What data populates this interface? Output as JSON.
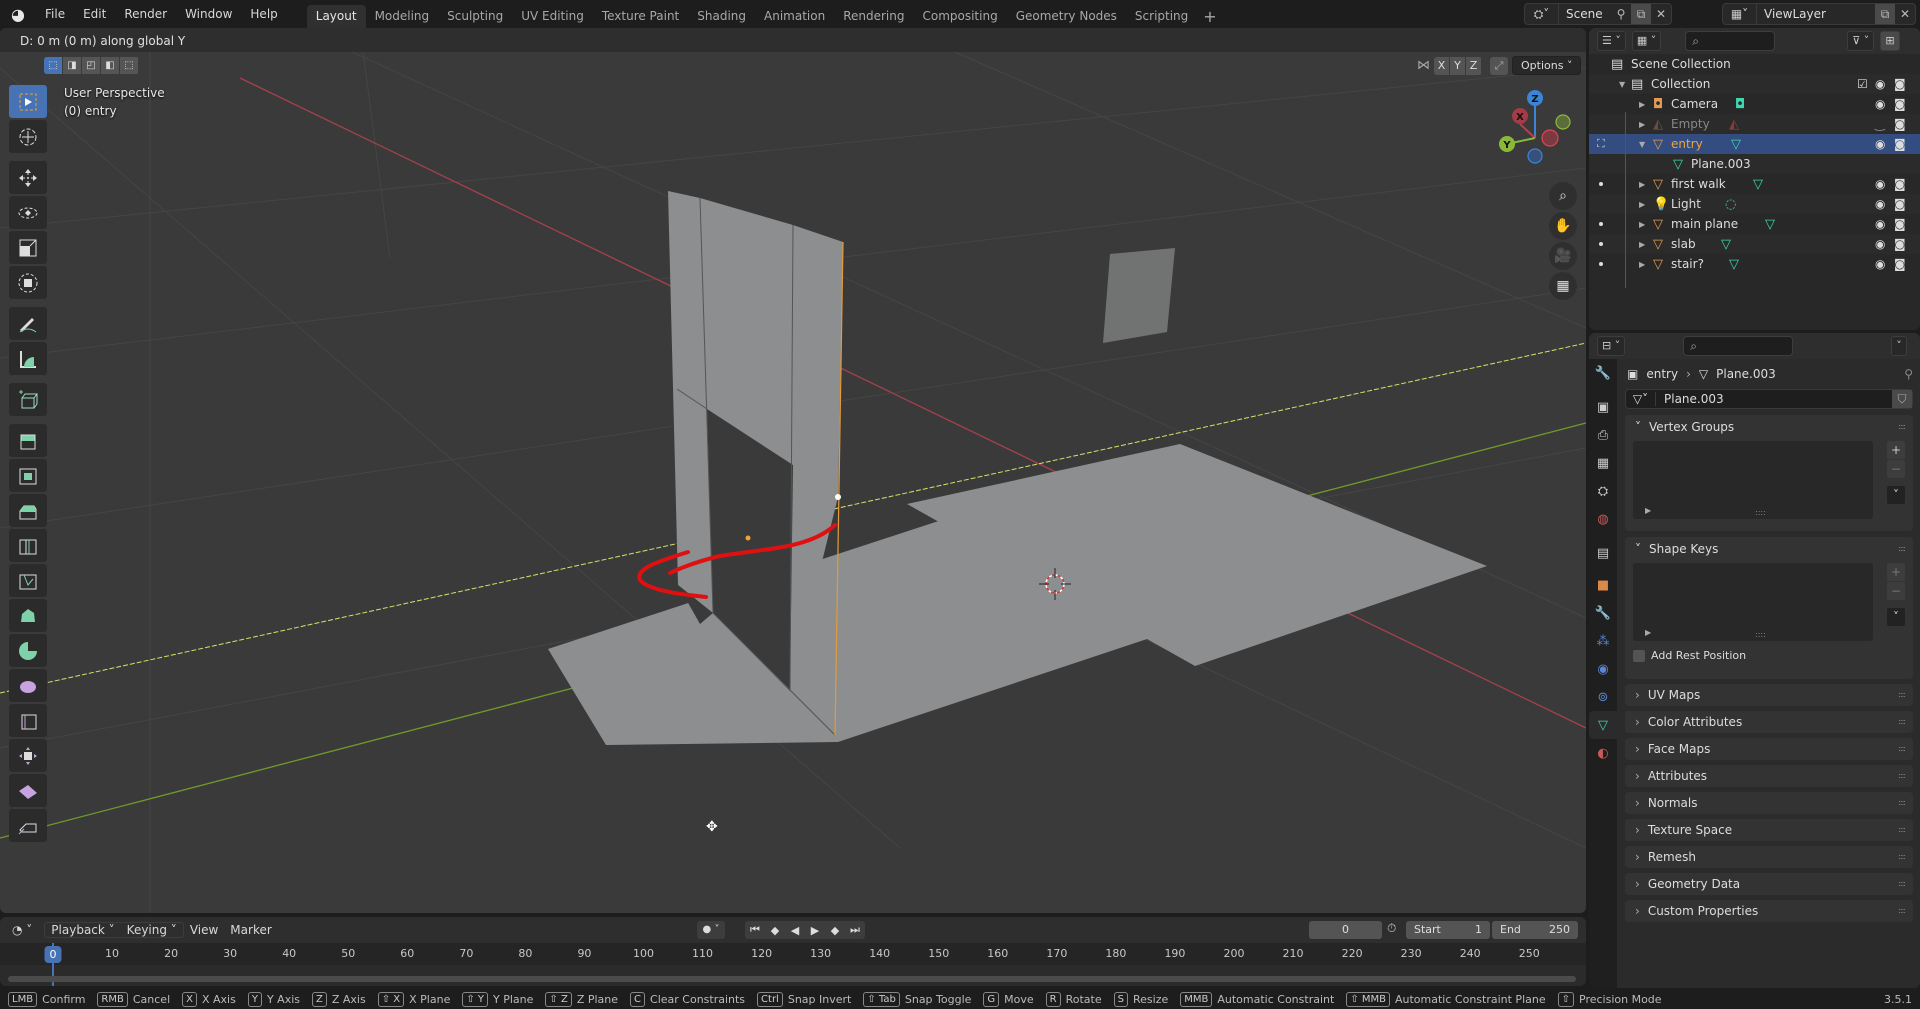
{
  "topbar": {
    "menus": [
      "File",
      "Edit",
      "Render",
      "Window",
      "Help"
    ],
    "workspaces": [
      "Layout",
      "Modeling",
      "Sculpting",
      "UV Editing",
      "Texture Paint",
      "Shading",
      "Animation",
      "Rendering",
      "Compositing",
      "Geometry Nodes",
      "Scripting"
    ],
    "active_workspace": "Layout",
    "add_workspace": "+",
    "scene": "Scene",
    "view_layer": "ViewLayer"
  },
  "viewport": {
    "header_status": "D: 0 m (0 m) along global Y",
    "view_name": "User Perspective",
    "object_info": "(0) entry",
    "axis_x": "X",
    "axis_y": "Y",
    "axis_z": "Z",
    "options_label": "Options",
    "gizmo": {
      "x": "X",
      "y": "Y",
      "z": "Z"
    },
    "colors": {
      "x_axis": "#b5404b",
      "y_axis": "#8ab93a",
      "z_axis": "#3c84d6",
      "mesh": "#8c8e90",
      "annotation": "#e01010",
      "bg": "#3a3a3a"
    }
  },
  "tools": [
    "select-box",
    "cursor",
    "move",
    "rotate",
    "scale",
    "transform",
    "annotate",
    "measure",
    "add-cube",
    "extrude-region",
    "inset-faces",
    "bevel",
    "loop-cut",
    "knife",
    "poly-build",
    "spin",
    "smooth",
    "edge-slide",
    "shrink-fatten",
    "shear",
    "rip-region"
  ],
  "timeline": {
    "playback": "Playback",
    "keying": "Keying",
    "view": "View",
    "marker": "Marker",
    "current_frame": "0",
    "start_label": "Start",
    "start": "1",
    "end_label": "End",
    "end": "250",
    "ruler": [
      "0",
      "10",
      "20",
      "30",
      "40",
      "50",
      "60",
      "70",
      "80",
      "90",
      "100",
      "110",
      "120",
      "130",
      "140",
      "150",
      "160",
      "170",
      "180",
      "190",
      "200",
      "210",
      "220",
      "230",
      "240",
      "250"
    ]
  },
  "statusbar": {
    "items": [
      {
        "key": "LMB",
        "label": "Confirm"
      },
      {
        "key": "RMB",
        "label": "Cancel"
      },
      {
        "key": "X",
        "label": "X Axis"
      },
      {
        "key": "Y",
        "label": "Y Axis"
      },
      {
        "key": "Z",
        "label": "Z Axis"
      },
      {
        "key": "⇧ X",
        "label": "X Plane"
      },
      {
        "key": "⇧ Y",
        "label": "Y Plane"
      },
      {
        "key": "⇧ Z",
        "label": "Z Plane"
      },
      {
        "key": "C",
        "label": "Clear Constraints"
      },
      {
        "key": "Ctrl",
        "label": "Snap Invert"
      },
      {
        "key": "⇧ Tab",
        "label": "Snap Toggle"
      },
      {
        "key": "G",
        "label": "Move"
      },
      {
        "key": "R",
        "label": "Rotate"
      },
      {
        "key": "S",
        "label": "Resize"
      },
      {
        "key": "MMB",
        "label": "Automatic Constraint"
      },
      {
        "key": "⇧ MMB",
        "label": "Automatic Constraint Plane"
      },
      {
        "key": "⇧",
        "label": "Precision Mode"
      }
    ],
    "version": "3.5.1"
  },
  "outliner": {
    "scene_collection": "Scene Collection",
    "collection": "Collection",
    "rows": [
      {
        "label": "Camera",
        "type": "camera"
      },
      {
        "label": "Empty",
        "type": "empty"
      },
      {
        "label": "entry",
        "type": "mesh",
        "selected": true
      },
      {
        "label": "Plane.003",
        "type": "mesh-data"
      },
      {
        "label": "first walk",
        "type": "mesh"
      },
      {
        "label": "Light",
        "type": "light"
      },
      {
        "label": "main plane",
        "type": "mesh"
      },
      {
        "label": "slab",
        "type": "mesh"
      },
      {
        "label": "stair?",
        "type": "mesh"
      }
    ]
  },
  "properties": {
    "breadcrumb_object": "entry",
    "breadcrumb_data": "Plane.003",
    "mesh_name": "Plane.003",
    "panels": {
      "vertex_groups": "Vertex Groups",
      "shape_keys": "Shape Keys",
      "add_rest_position": "Add Rest Position",
      "collapsed": [
        "UV Maps",
        "Color Attributes",
        "Face Maps",
        "Attributes",
        "Normals",
        "Texture Space",
        "Remesh",
        "Geometry Data",
        "Custom Properties"
      ]
    }
  }
}
